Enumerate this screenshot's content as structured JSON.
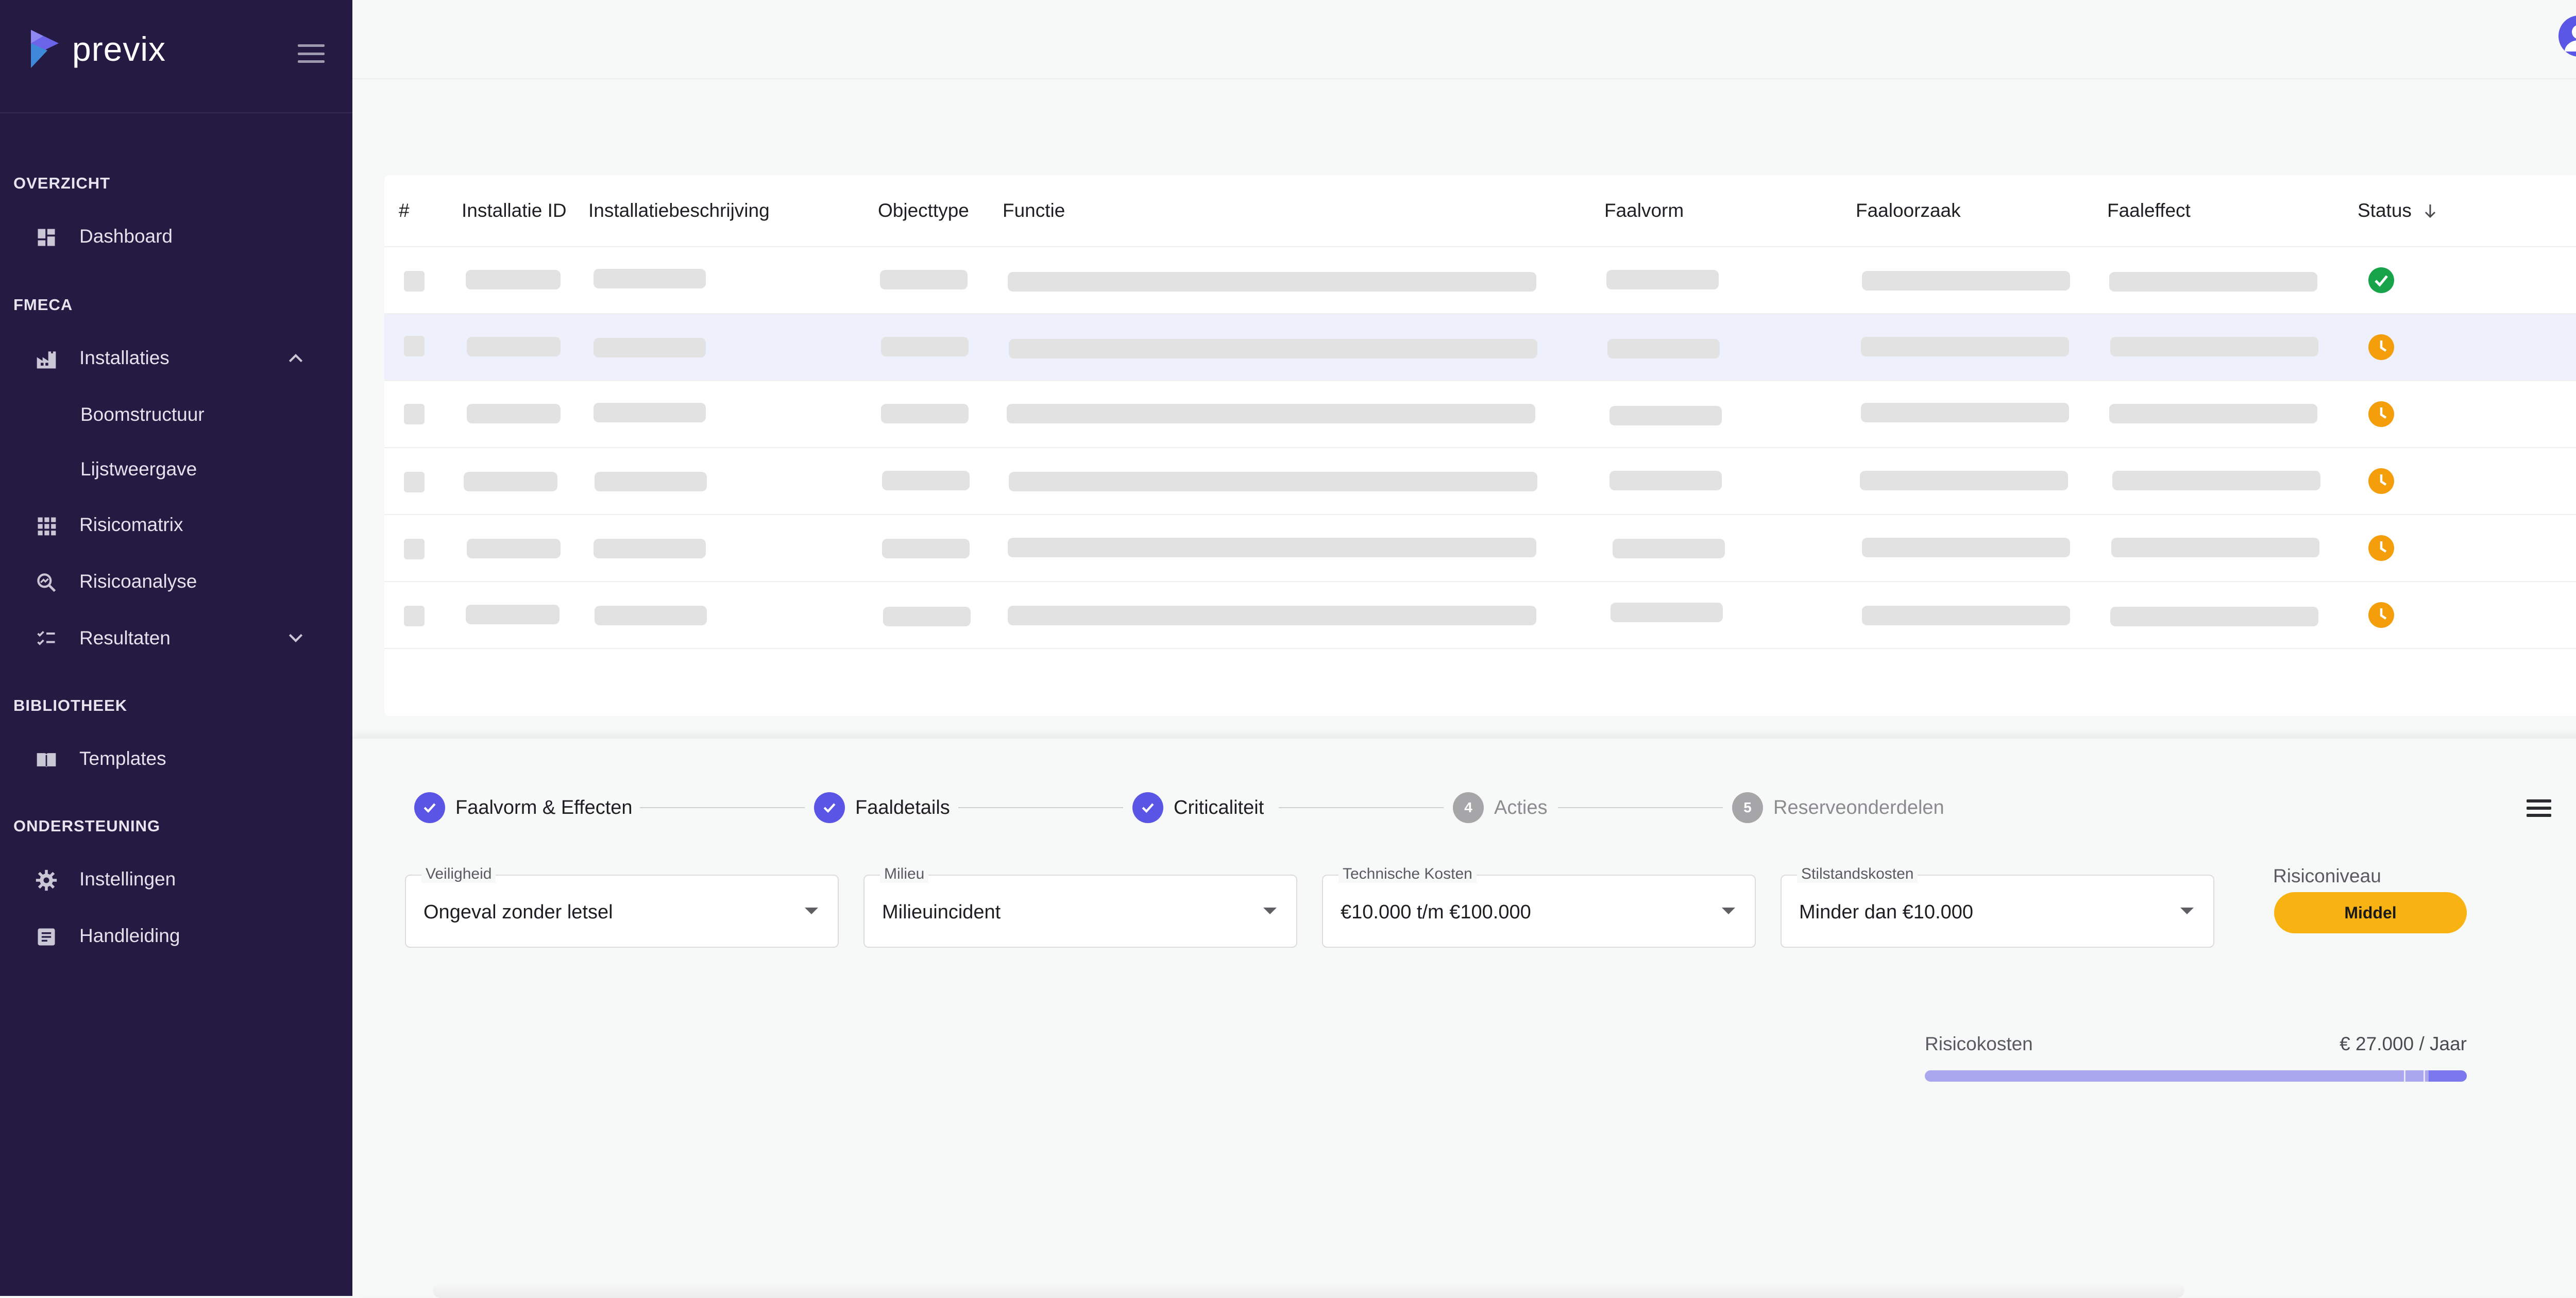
{
  "brand": {
    "name": "previx"
  },
  "sidebar": {
    "sections": [
      {
        "title": "OVERZICHT"
      },
      {
        "title": "FMECA"
      },
      {
        "title": "BIBLIOTHEEK"
      },
      {
        "title": "ONDERSTEUNING"
      }
    ],
    "items": [
      {
        "label": "Dashboard",
        "icon": "dashboard-icon"
      },
      {
        "label": "Installaties",
        "icon": "factory-icon",
        "expanded": true
      },
      {
        "label": "Boomstructuur"
      },
      {
        "label": "Lijstweergave"
      },
      {
        "label": "Risicomatrix",
        "icon": "grid-icon"
      },
      {
        "label": "Risicoanalyse",
        "icon": "search-analysis-icon"
      },
      {
        "label": "Resultaten",
        "icon": "checklist-icon",
        "expanded": false
      },
      {
        "label": "Templates",
        "icon": "book-icon"
      },
      {
        "label": "Instellingen",
        "icon": "gear-icon"
      },
      {
        "label": "Handleiding",
        "icon": "document-icon"
      }
    ]
  },
  "table": {
    "columns": [
      "#",
      "Installatie ID",
      "Installatiebeschrijving",
      "Objecttype",
      "Functie",
      "Faalvorm",
      "Faaloorzaak",
      "Faaleffect",
      "Status"
    ],
    "sort_column": "Status",
    "rows": [
      {
        "status": "complete"
      },
      {
        "status": "pending",
        "highlighted": true
      },
      {
        "status": "pending"
      },
      {
        "status": "pending"
      },
      {
        "status": "pending"
      },
      {
        "status": "pending"
      }
    ]
  },
  "stepper": {
    "steps": [
      {
        "number": "1",
        "label": "Faalvorm & Effecten",
        "state": "done"
      },
      {
        "number": "2",
        "label": "Faaldetails",
        "state": "done"
      },
      {
        "number": "3",
        "label": "Criticaliteit",
        "state": "done"
      },
      {
        "number": "4",
        "label": "Acties",
        "state": "todo"
      },
      {
        "number": "5",
        "label": "Reserveonderdelen",
        "state": "todo"
      }
    ]
  },
  "criticality": {
    "fields": [
      {
        "label": "Veiligheid",
        "value": "Ongeval zonder letsel"
      },
      {
        "label": "Milieu",
        "value": "Milieuincident"
      },
      {
        "label": "Technische Kosten",
        "value": "€10.000 t/m €100.000"
      },
      {
        "label": "Stilstandskosten",
        "value": "Minder dan €10.000"
      }
    ],
    "risk_level_label": "Risiconiveau",
    "risk_level": "Middel",
    "risk_level_color": "#f8b313"
  },
  "risk_cost": {
    "label": "Risicokosten",
    "value": "€ 27.000 / Jaar",
    "bar_fill_fraction": 0.93
  },
  "colors": {
    "sidebar_bg": "#241a42",
    "accent": "#5b55e6",
    "status_done": "#16a34a",
    "status_pending": "#f59e0b"
  }
}
